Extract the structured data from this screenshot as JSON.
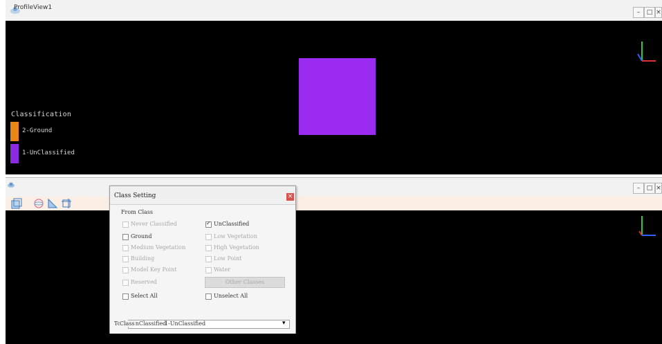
{
  "top_window": {
    "buttons": {
      "minimize": "–",
      "maximize": "□",
      "close": "×"
    },
    "legend": {
      "title": "Classification",
      "items": [
        {
          "label": "2-Ground",
          "color": "#e88618"
        },
        {
          "label": "1-UnClassified",
          "color": "#8a2be2"
        }
      ]
    },
    "square_color": "#9b2bf0"
  },
  "bottom_window": {
    "title": "ProfileView1",
    "buttons": {
      "minimize": "–",
      "maximize": "□",
      "close": "×"
    },
    "toolbar_icons": [
      "box-select-icon",
      "sphere-icon",
      "measure-icon",
      "crop-icon"
    ]
  },
  "class_setting_dialog": {
    "title": "Class Setting",
    "close": "×",
    "section_label": "From Class",
    "checkboxes": [
      {
        "label": "Never Classified",
        "checked": false,
        "enabled": false
      },
      {
        "label": "UnClassified",
        "checked": true,
        "enabled": true
      },
      {
        "label": "Ground",
        "checked": false,
        "enabled": true
      },
      {
        "label": "Low Vegetation",
        "checked": false,
        "enabled": false
      },
      {
        "label": "Medium Vegetation",
        "checked": false,
        "enabled": false
      },
      {
        "label": "High Vegetation",
        "checked": false,
        "enabled": false
      },
      {
        "label": "Building",
        "checked": false,
        "enabled": false
      },
      {
        "label": "Low Point",
        "checked": false,
        "enabled": false
      },
      {
        "label": "Model Key Point",
        "checked": false,
        "enabled": false
      },
      {
        "label": "Water",
        "checked": false,
        "enabled": false
      },
      {
        "label": "Reserved",
        "checked": false,
        "enabled": false
      }
    ],
    "other_classes_button": "Other Classes",
    "select_all": "Select All",
    "unselect_all": "Unselect All",
    "to_class_label": "To",
    "class_label": "Class",
    "to_class_value": "UnClassified",
    "to_class_value_full": "1-UnClassified",
    "dropdown_arrow": "▾"
  }
}
